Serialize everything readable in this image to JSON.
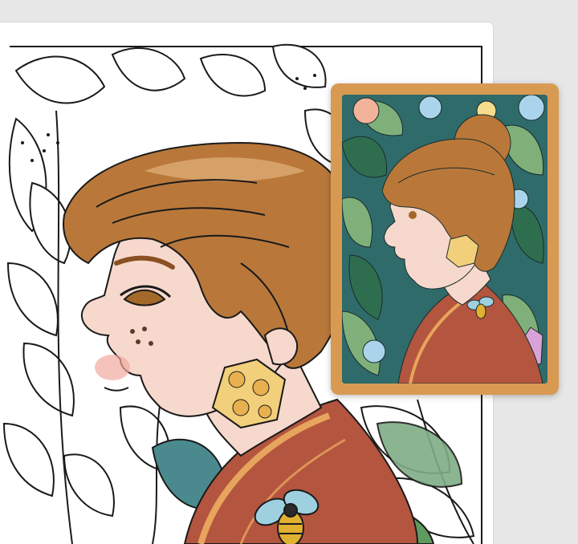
{
  "page": {
    "background": "#e7e7e7",
    "sheet_color": "#ffffff",
    "line_color": "#1a1a1a"
  },
  "line_art": {
    "subject": "coloring-page-portrait",
    "colored_parts": [
      "hair",
      "skin",
      "earring",
      "kimono",
      "bee-brooch",
      "leaves-lower-right"
    ],
    "palette": {
      "hair": "#b9783a",
      "hair_light": "#e2b27c",
      "skin": "#f7d8cc",
      "cheek": "#f2a9a0",
      "earring": "#f2cf7a",
      "earring_dots": "#e8b04f",
      "kimono": "#b4553f",
      "kimono_stripe": "#e7a45c",
      "leaf_teal": "#4a8a8e",
      "leaf_green": "#6fa06a",
      "bee_wing": "#9fd0e0",
      "bee_body": "#e0b030"
    }
  },
  "reference_card": {
    "frame_color": "#d89a52",
    "background": "#2f6b6a",
    "palette": {
      "leaf_dark": "#2e6e4f",
      "leaf_light": "#7fb07a",
      "flower_pink": "#f3b39a",
      "flower_blue": "#a9d4ec",
      "flower_yellow": "#f6dd8e",
      "crystal": "#d9a3d8"
    }
  }
}
